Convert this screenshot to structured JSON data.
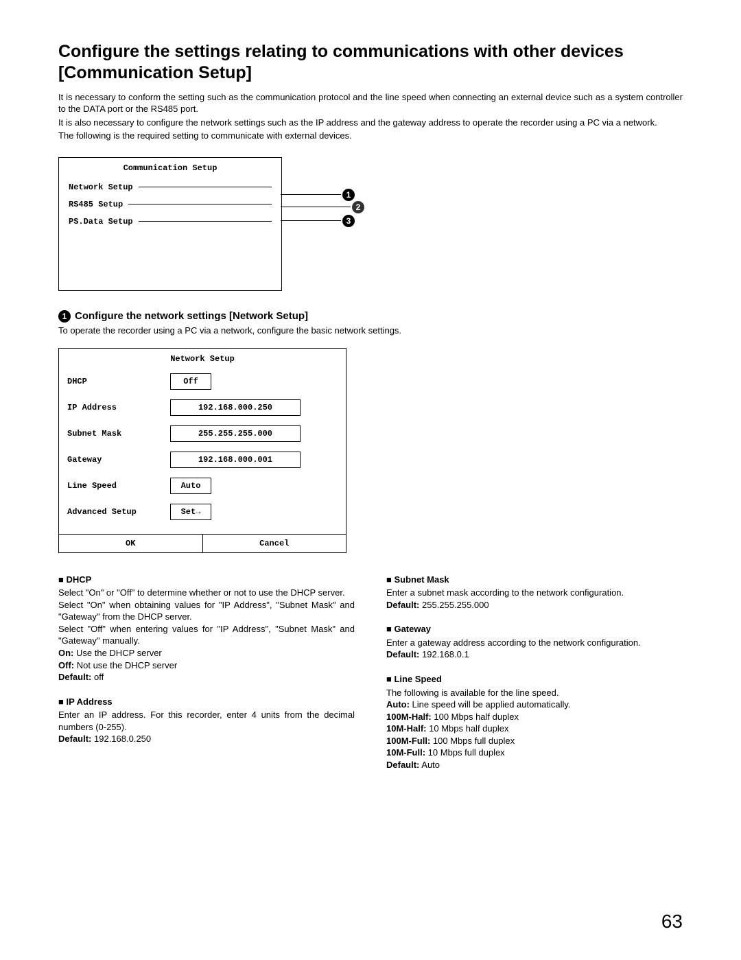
{
  "title": "Configure the settings relating to communications with other devices [Communication Setup]",
  "intro": {
    "p1": "It is necessary to conform the setting such as the communication protocol and the line speed when connecting an external device such as a system controller to the DATA port or the RS485 port.",
    "p2": "It is also necessary to configure the network settings such as the IP address and the gateway address to operate the recorder using a PC via a network.",
    "p3": "The following is the required setting to communicate with external devices."
  },
  "comm_box": {
    "title": "Communication Setup",
    "items": [
      "Network Setup",
      "RS485 Setup",
      "PS.Data Setup"
    ],
    "callouts": [
      "1",
      "2",
      "3"
    ]
  },
  "section1": {
    "num": "1",
    "heading": "Configure the network settings [Network Setup]",
    "desc": "To operate the recorder using a PC via a network, configure the basic network settings."
  },
  "net_box": {
    "title": "Network Setup",
    "rows": [
      {
        "label": "DHCP",
        "value": "Off",
        "wide": false
      },
      {
        "label": "IP Address",
        "value": "192.168.000.250",
        "wide": true
      },
      {
        "label": "Subnet Mask",
        "value": "255.255.255.000",
        "wide": true
      },
      {
        "label": "Gateway",
        "value": "192.168.000.001",
        "wide": true
      },
      {
        "label": "Line Speed",
        "value": "Auto",
        "wide": false
      },
      {
        "label": "Advanced Setup",
        "value": "Set→",
        "wide": false
      }
    ],
    "buttons": {
      "ok": "OK",
      "cancel": "Cancel"
    }
  },
  "left": {
    "dhcp": {
      "title": "■ DHCP",
      "p1": "Select \"On\" or \"Off\" to determine whether or not to use the DHCP server.",
      "p2": "Select \"On\" when obtaining values for \"IP Address\", \"Subnet Mask\" and \"Gateway\" from the DHCP server.",
      "p3": "Select \"Off\" when entering values for \"IP Address\", \"Subnet Mask\" and \"Gateway\" manually.",
      "on": {
        "k": "On:",
        "v": " Use the DHCP server"
      },
      "off": {
        "k": "Off:",
        "v": " Not use the DHCP server"
      },
      "def": {
        "k": "Default:",
        "v": " off"
      }
    },
    "ip": {
      "title": "■ IP Address",
      "p1": "Enter an IP address. For this recorder, enter 4 units from the decimal numbers (0-255).",
      "def": {
        "k": "Default:",
        "v": " 192.168.0.250"
      }
    }
  },
  "right": {
    "subnet": {
      "title": "■ Subnet Mask",
      "p1": "Enter a subnet mask according to the network configuration.",
      "def": {
        "k": "Default:",
        "v": " 255.255.255.000"
      }
    },
    "gateway": {
      "title": "■ Gateway",
      "p1": "Enter a gateway address according to the network configuration.",
      "def": {
        "k": "Default:",
        "v": " 192.168.0.1"
      }
    },
    "linespeed": {
      "title": "■ Line Speed",
      "p1": "The following is available for the line speed.",
      "auto": {
        "k": "Auto:",
        "v": " Line speed will be applied automatically."
      },
      "h100": {
        "k": "100M-Half:",
        "v": " 100 Mbps half duplex"
      },
      "h10": {
        "k": "10M-Half:",
        "v": " 10 Mbps half duplex"
      },
      "f100": {
        "k": "100M-Full:",
        "v": " 100 Mbps full duplex"
      },
      "f10": {
        "k": "10M-Full:",
        "v": " 10 Mbps full duplex"
      },
      "def": {
        "k": "Default:",
        "v": " Auto"
      }
    }
  },
  "page_number": "63"
}
